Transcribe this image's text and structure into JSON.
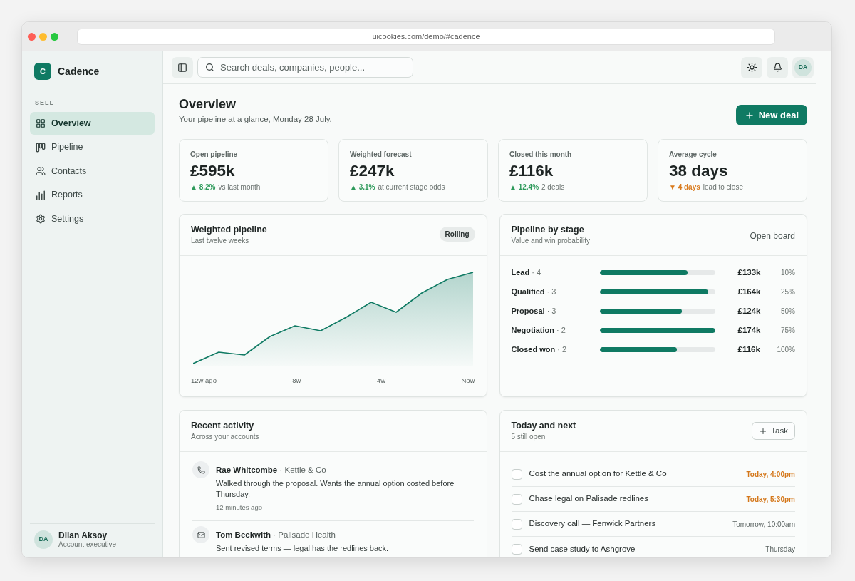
{
  "browser": {
    "url": "uicookies.com/demo/#cadence"
  },
  "sidebar": {
    "brand": {
      "initial": "C",
      "name": "Cadence"
    },
    "section_label": "SELL",
    "items": [
      {
        "kind": "overview",
        "label": "Overview",
        "selected": true
      },
      {
        "kind": "pipeline",
        "label": "Pipeline",
        "selected": false
      },
      {
        "kind": "contacts",
        "label": "Contacts",
        "selected": false
      },
      {
        "kind": "reports",
        "label": "Reports",
        "selected": false
      },
      {
        "kind": "settings",
        "label": "Settings",
        "selected": false
      }
    ],
    "user": {
      "initials": "DA",
      "name": "Dilan Aksoy",
      "role": "Account executive"
    }
  },
  "topbar": {
    "search": {
      "placeholder": "Search deals, companies, people..."
    },
    "avatar_initials": "DA"
  },
  "header": {
    "title": "Overview",
    "subtitle": "Your pipeline at a glance, Monday 28 July.",
    "action": "New deal"
  },
  "stats": [
    {
      "label": "Open pipeline",
      "value": "£595k",
      "change": "▲ 8.2%",
      "rising": true,
      "note": "vs last month"
    },
    {
      "label": "Weighted forecast",
      "value": "£247k",
      "change": "▲ 3.1%",
      "rising": true,
      "note": "at current stage odds"
    },
    {
      "label": "Closed this month",
      "value": "£116k",
      "change": "▲ 12.4%",
      "rising": true,
      "note": "2 deals"
    },
    {
      "label": "Average cycle",
      "value": "38 days",
      "change": "▼ 4 days",
      "rising": false,
      "note": "lead to close"
    }
  ],
  "weighted_pipeline": {
    "title": "Weighted pipeline",
    "subtitle": "Last twelve weeks",
    "badge": "Rolling",
    "axis_labels": [
      "12w ago",
      "8w",
      "4w",
      "Now"
    ]
  },
  "pipeline_by_stage": {
    "title": "Pipeline by stage",
    "subtitle": "Value and win probability",
    "link": "Open board",
    "stages": [
      {
        "label": "**Lead** · 4",
        "level": 0.76,
        "value": "£133k",
        "probability": "10%"
      },
      {
        "label": "**Qualified** · 3",
        "level": 0.94,
        "value": "£164k",
        "probability": "25%"
      },
      {
        "label": "**Proposal** · 3",
        "level": 0.71,
        "value": "£124k",
        "probability": "50%"
      },
      {
        "label": "**Negotiation** · 2",
        "level": 1,
        "value": "£174k",
        "probability": "75%"
      },
      {
        "label": "**Closed won** · 2",
        "level": 0.67,
        "value": "£116k",
        "probability": "100%"
      }
    ]
  },
  "recent_activity": {
    "title": "Recent activity",
    "subtitle": "Across your accounts",
    "items": [
      {
        "kind": "call",
        "heading": "**Rae Whitcombe** · Kettle & Co",
        "text": "Walked through the proposal. Wants the annual option costed before Thursday.",
        "time": "12 minutes ago"
      },
      {
        "kind": "email",
        "heading": "**Tom Beckwith** · Palisade Health",
        "text": "Sent revised terms — legal has the redlines back."
      }
    ]
  },
  "today_and_next": {
    "title": "Today and next",
    "subtitle": "5 still open",
    "button": "Task",
    "tasks": [
      {
        "label": "Cost the annual option for Kettle & Co",
        "due": "Today, 4:00pm",
        "urgent": true,
        "checked": false
      },
      {
        "label": "Chase legal on Palisade redlines",
        "due": "Today, 5:30pm",
        "urgent": true,
        "checked": false
      },
      {
        "label": "Discovery call — Fenwick Partners",
        "due": "Tomorrow, 10:00am",
        "urgent": false,
        "checked": false
      },
      {
        "label": "Send case study to Ashgrove",
        "due": "Thursday",
        "urgent": false,
        "checked": false
      }
    ]
  }
}
